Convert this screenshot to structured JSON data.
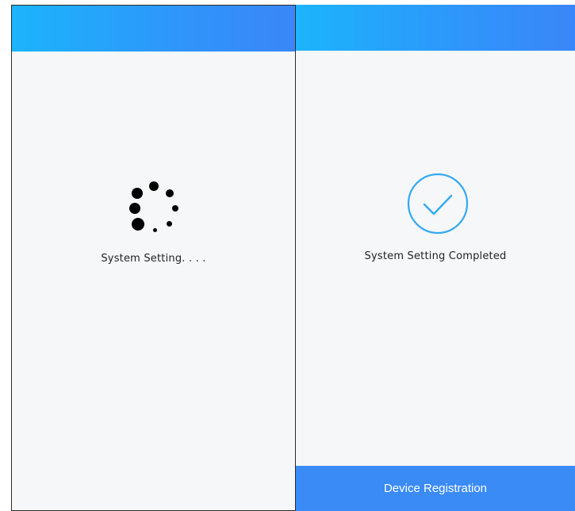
{
  "screens": [
    {
      "status_text": "System Setting. . . .",
      "indicator_icon": "loading-spinner-icon"
    },
    {
      "status_text": "System Setting Completed",
      "indicator_icon": "check-circle-icon",
      "primary_button_label": "Device Registration"
    }
  ],
  "colors": {
    "header_gradient_start": "#1cb4fb",
    "header_gradient_end": "#3b86f8",
    "screen_background": "#f6f7f9",
    "check_circle": "#33a9f0",
    "button_background": "#3a8bf5",
    "button_text": "#ffffff",
    "spinner_dots": "#000000"
  }
}
